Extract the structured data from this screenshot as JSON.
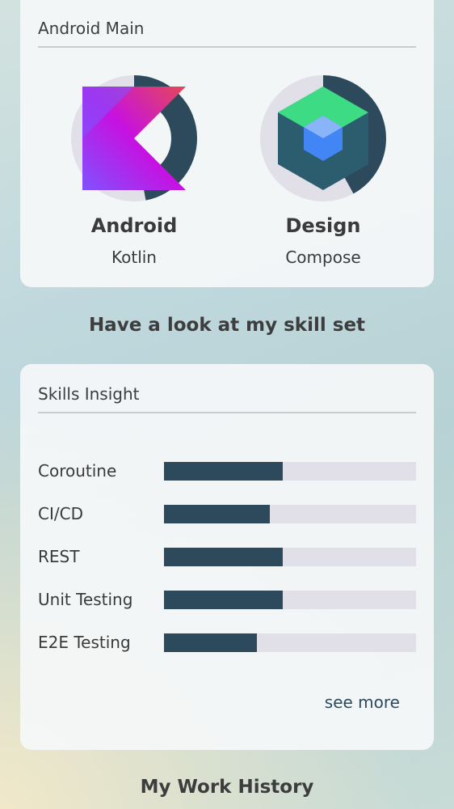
{
  "main_card": {
    "title": "Android Main",
    "donuts": [
      {
        "name": "Android",
        "sub": "Kotlin",
        "icon": "kotlin-icon",
        "fill_fraction": 0.47
      },
      {
        "name": "Design",
        "sub": "Compose",
        "icon": "compose-icon",
        "fill_fraction": 0.42
      }
    ]
  },
  "skillset_heading": "Have a look at my skill set",
  "skills_card": {
    "title": "Skills Insight",
    "skills": [
      {
        "label": "Coroutine",
        "level": 0.47
      },
      {
        "label": "CI/CD",
        "level": 0.42
      },
      {
        "label": "REST",
        "level": 0.47
      },
      {
        "label": "Unit Testing",
        "level": 0.47
      },
      {
        "label": "E2E Testing",
        "level": 0.37
      }
    ],
    "see_more": "see more"
  },
  "work_heading": "My Work History",
  "colors": {
    "accent": "#2d4a5c",
    "track": "#e1dfe7",
    "card": "#f5f7f9"
  }
}
